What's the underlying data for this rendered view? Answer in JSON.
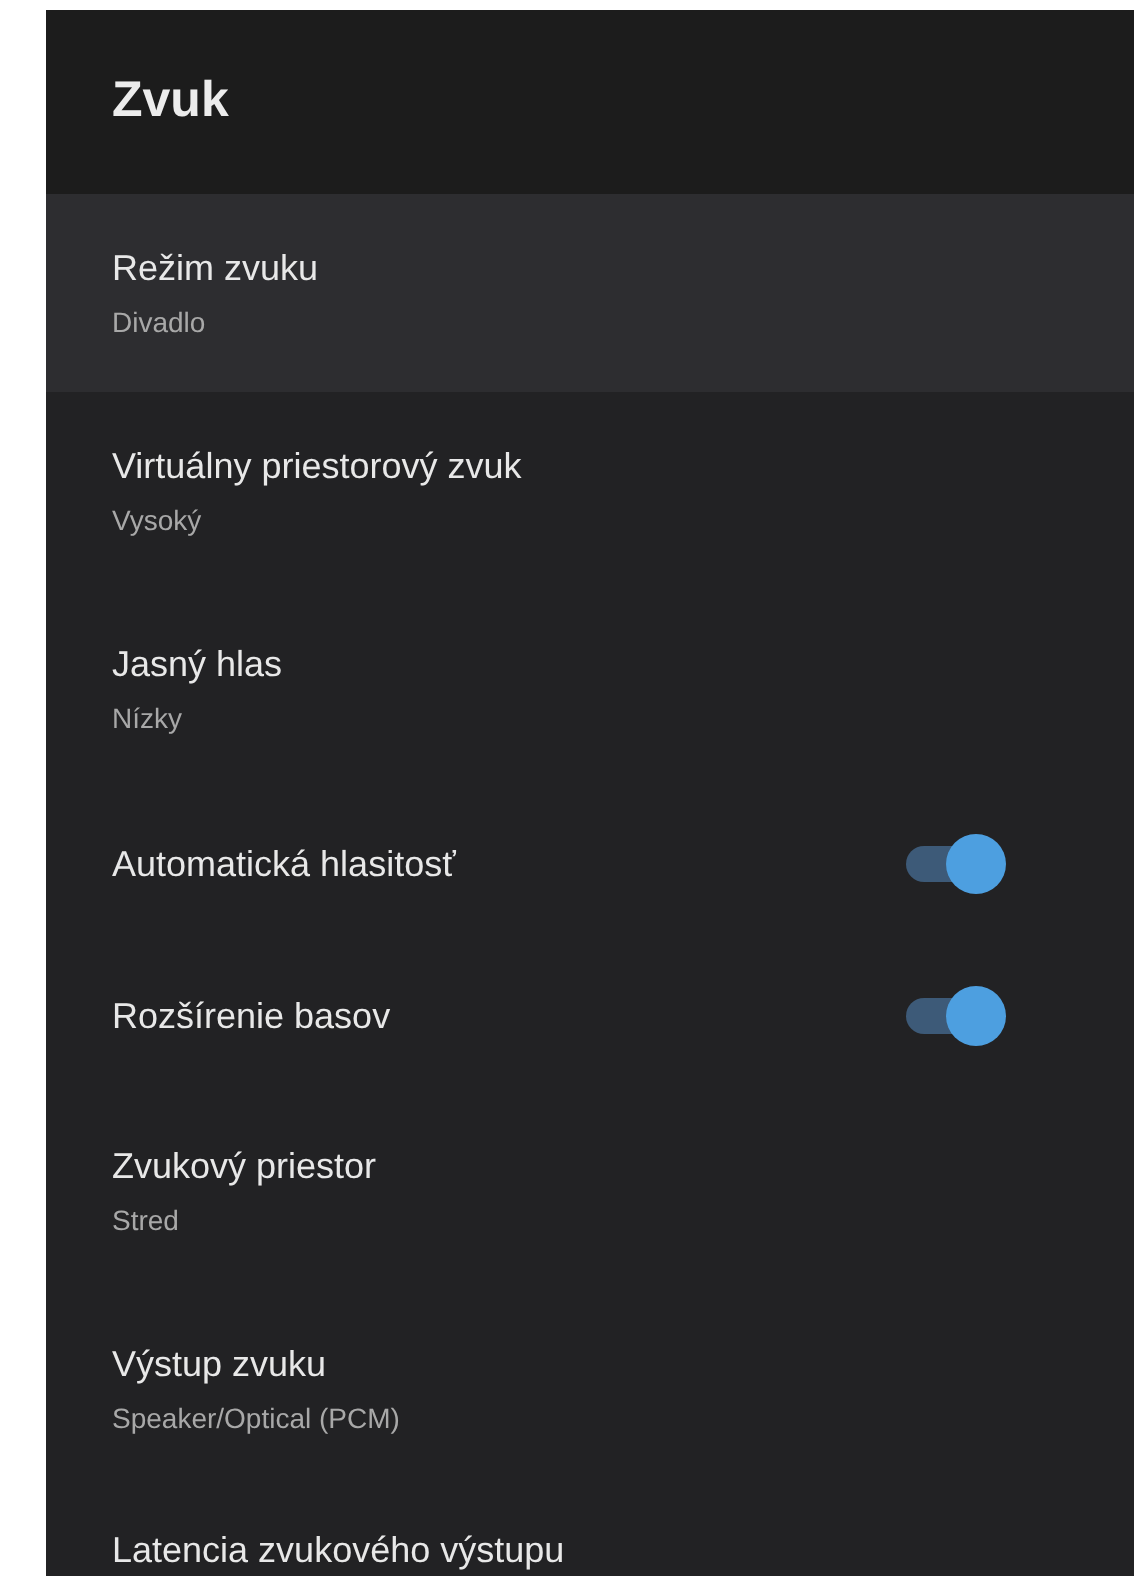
{
  "header": {
    "title": "Zvuk"
  },
  "items": [
    {
      "kind": "option",
      "title": "Režim zvuku",
      "value": "Divadlo",
      "selected": true
    },
    {
      "kind": "option",
      "title": "Virtuálny priestorový zvuk",
      "value": "Vysoký",
      "selected": false
    },
    {
      "kind": "option",
      "title": "Jasný hlas",
      "value": "Nízky",
      "selected": false
    },
    {
      "kind": "toggle",
      "title": "Automatická hlasitosť",
      "on": true,
      "selected": false
    },
    {
      "kind": "toggle",
      "title": "Rozšírenie basov",
      "on": true,
      "selected": false
    },
    {
      "kind": "option",
      "title": "Zvukový priestor",
      "value": "Stred",
      "selected": false
    },
    {
      "kind": "option",
      "title": "Výstup zvuku",
      "value": "Speaker/Optical (PCM)",
      "selected": false
    },
    {
      "kind": "option",
      "title": "Latencia zvukového výstupu",
      "selected": false
    }
  ]
}
